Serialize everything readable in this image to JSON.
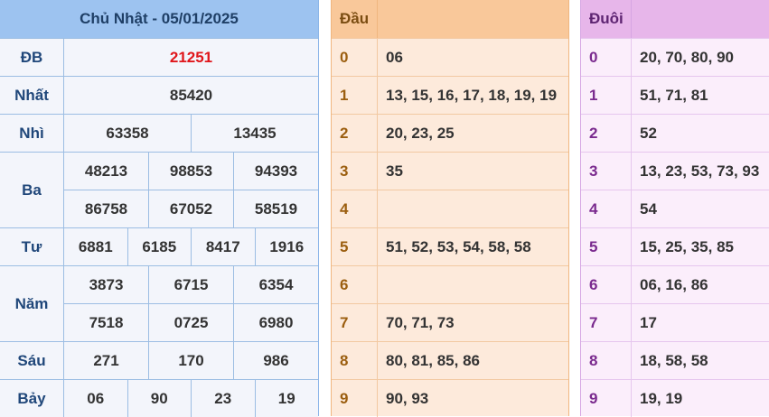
{
  "results": {
    "title": "Chủ Nhật - 05/01/2025",
    "prizes": [
      {
        "label": "ĐB",
        "rows": [
          [
            "21251"
          ]
        ],
        "special": true
      },
      {
        "label": "Nhất",
        "rows": [
          [
            "85420"
          ]
        ]
      },
      {
        "label": "Nhì",
        "rows": [
          [
            "63358",
            "13435"
          ]
        ]
      },
      {
        "label": "Ba",
        "rows": [
          [
            "48213",
            "98853",
            "94393"
          ],
          [
            "86758",
            "67052",
            "58519"
          ]
        ]
      },
      {
        "label": "Tư",
        "rows": [
          [
            "6881",
            "6185",
            "8417",
            "1916"
          ]
        ]
      },
      {
        "label": "Năm",
        "rows": [
          [
            "3873",
            "6715",
            "6354"
          ],
          [
            "7518",
            "0725",
            "6980"
          ]
        ]
      },
      {
        "label": "Sáu",
        "rows": [
          [
            "271",
            "170",
            "986"
          ]
        ]
      },
      {
        "label": "Bảy",
        "rows": [
          [
            "06",
            "90",
            "23",
            "19"
          ]
        ]
      }
    ]
  },
  "dau": {
    "header": "Đầu",
    "rows": [
      {
        "num": "0",
        "values": "06"
      },
      {
        "num": "1",
        "values": "13, 15, 16, 17, 18, 19, 19"
      },
      {
        "num": "2",
        "values": "20, 23, 25"
      },
      {
        "num": "3",
        "values": "35"
      },
      {
        "num": "4",
        "values": ""
      },
      {
        "num": "5",
        "values": "51, 52, 53, 54, 58, 58"
      },
      {
        "num": "6",
        "values": ""
      },
      {
        "num": "7",
        "values": "70, 71, 73"
      },
      {
        "num": "8",
        "values": "80, 81, 85, 86"
      },
      {
        "num": "9",
        "values": "90, 93"
      }
    ]
  },
  "duoi": {
    "header": "Đuôi",
    "rows": [
      {
        "num": "0",
        "values": "20, 70, 80, 90"
      },
      {
        "num": "1",
        "values": "51, 71, 81"
      },
      {
        "num": "2",
        "values": "52"
      },
      {
        "num": "3",
        "values": "13, 23, 53, 73, 93"
      },
      {
        "num": "4",
        "values": "54"
      },
      {
        "num": "5",
        "values": "15, 25, 35, 85"
      },
      {
        "num": "6",
        "values": "06, 16, 86"
      },
      {
        "num": "7",
        "values": "17"
      },
      {
        "num": "8",
        "values": "18, 58, 58"
      },
      {
        "num": "9",
        "values": "19, 19"
      }
    ]
  }
}
